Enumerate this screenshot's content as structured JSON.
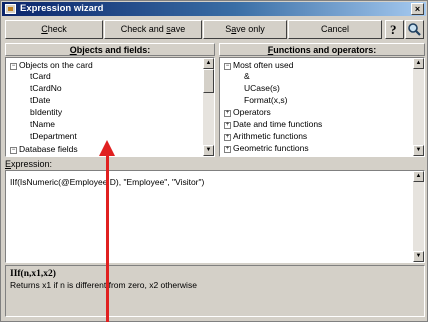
{
  "window": {
    "title": "Expression wizard",
    "close_glyph": "×"
  },
  "toolbar": {
    "check": {
      "pre": "",
      "key": "C",
      "post": "heck"
    },
    "check_save": {
      "pre": "Check and ",
      "key": "s",
      "post": "ave"
    },
    "save_only": {
      "pre": "S",
      "key": "a",
      "post": "ve only"
    },
    "cancel": "Cancel",
    "help_icon": "?",
    "search_icon": "magnifier-icon"
  },
  "objects": {
    "header": {
      "key": "O",
      "post": "bjects and fields:"
    },
    "items": [
      {
        "label": "Objects on the card",
        "expander": "−"
      },
      {
        "label": "tCard"
      },
      {
        "label": "tCardNo"
      },
      {
        "label": "tDate"
      },
      {
        "label": "bIdentity"
      },
      {
        "label": "tName"
      },
      {
        "label": "tDepartment"
      },
      {
        "label": "Database fields",
        "expander": "−"
      }
    ]
  },
  "functions": {
    "header": {
      "key": "F",
      "post": "unctions and operators:"
    },
    "items": [
      {
        "label": "Most often used",
        "expander": "−"
      },
      {
        "label": "&"
      },
      {
        "label": "UCase(s)"
      },
      {
        "label": "Format(x,s)"
      },
      {
        "label": "Operators",
        "expander": "+"
      },
      {
        "label": "Date and time functions",
        "expander": "+"
      },
      {
        "label": "Arithmetic functions",
        "expander": "+"
      },
      {
        "label": "Geometric functions",
        "expander": "+"
      }
    ]
  },
  "expression": {
    "label": {
      "key": "E",
      "post": "xpression:"
    },
    "value": "IIf(IsNumeric(@EmployeeID), \"Employee\", \"Visitor\")"
  },
  "help": {
    "signature": "IIf(n,x1,x2)",
    "description": "Returns x1 if n is different from zero, x2 otherwise"
  },
  "colors": {
    "title_start": "#0a246a",
    "title_end": "#a6caf0",
    "annotation_arrow": "#e02020"
  }
}
